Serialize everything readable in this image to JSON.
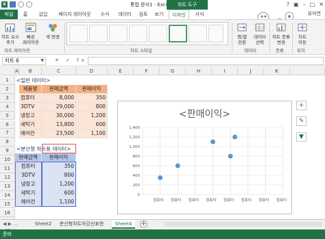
{
  "window": {
    "title": "통합 문서1 - Excel",
    "chart_tools": "차트 도구",
    "user": "유미연"
  },
  "tabs": [
    "파일",
    "홈",
    "삽입",
    "페이지 레이아웃",
    "수식",
    "데이터",
    "검토",
    "보기",
    "디자인",
    "서식"
  ],
  "ribbon": {
    "add_element": "차트 요소\n추가",
    "quick_layout": "빠른\n레이아웃",
    "change_color": "색 변경",
    "layout_group": "차트 레이아웃",
    "styles_group": "차트 스타일",
    "switch_row_col": "행/열\n전환",
    "select_data": "데이터\n선택",
    "data_group": "데이터",
    "change_type": "차트 종류\n변경",
    "type_group": "종류",
    "move_chart": "차트\n이동",
    "location_group": "위치"
  },
  "name_box": "차트 6",
  "formula_icons": "✕ ✓ fx",
  "columns": [
    "A",
    "B",
    "C",
    "D",
    "E",
    "F",
    "G",
    "H",
    "I",
    "J",
    "K"
  ],
  "rows": [
    "1",
    "2",
    "3",
    "4",
    "5",
    "6",
    "7",
    "8",
    "9",
    "10",
    "11",
    "12",
    "13",
    "14",
    "15",
    "16",
    "17",
    "18"
  ],
  "table1": {
    "title": "<일반 데이터>",
    "headers": [
      "제품명",
      "판매금액",
      "판매이익"
    ],
    "rows": [
      [
        "컴퓨터",
        "8,000",
        "350"
      ],
      [
        "3DTV",
        "29,000",
        "800"
      ],
      [
        "냉장고",
        "30,000",
        "1,200"
      ],
      [
        "세탁기",
        "13,800",
        "600"
      ],
      [
        "에어컨",
        "23,500",
        "1,100"
      ]
    ]
  },
  "table2": {
    "title": "<분산형 차트용 데이터>",
    "headers": [
      "판매금액",
      "판매이익"
    ],
    "rows": [
      [
        "컴퓨터",
        "350"
      ],
      [
        "3DTV",
        "800"
      ],
      [
        "냉장고",
        "1,200"
      ],
      [
        "세탁기",
        "600"
      ],
      [
        "에어컨",
        "1,100"
      ]
    ]
  },
  "chart_data": {
    "type": "scatter",
    "title": "<판매이익>",
    "x_tick_labels": [
      "컴퓨터",
      "컴퓨터",
      "컴퓨터",
      "컴퓨터",
      "컴퓨터",
      "컴퓨터",
      "컴퓨터",
      "컴퓨터"
    ],
    "y_ticks": [
      "0",
      "200",
      "400",
      "600",
      "800",
      "1,000",
      "1,200",
      "1,400"
    ],
    "ylim": [
      0,
      1400
    ],
    "xlim": [
      0,
      8
    ],
    "points": [
      {
        "x": 1,
        "y": 350
      },
      {
        "x": 2,
        "y": 600
      },
      {
        "x": 4,
        "y": 1100
      },
      {
        "x": 5,
        "y": 800
      },
      {
        "x": 5.25,
        "y": 1200
      }
    ],
    "grid": true,
    "marker_color": "#5b9bd5"
  },
  "sheets": {
    "nav": "◀ ▶ ...",
    "tabs": [
      "Sheet2",
      "분산형차트하강선표현",
      "Sheet4"
    ],
    "active": "Sheet4",
    "add": "+"
  },
  "status": "준비",
  "colors": {
    "excel_green": "#217346",
    "header_orange": "#f4b183",
    "body_orange": "#fce4d6",
    "header_blue": "#b4c6e7",
    "body_blue": "#dae3f3"
  }
}
